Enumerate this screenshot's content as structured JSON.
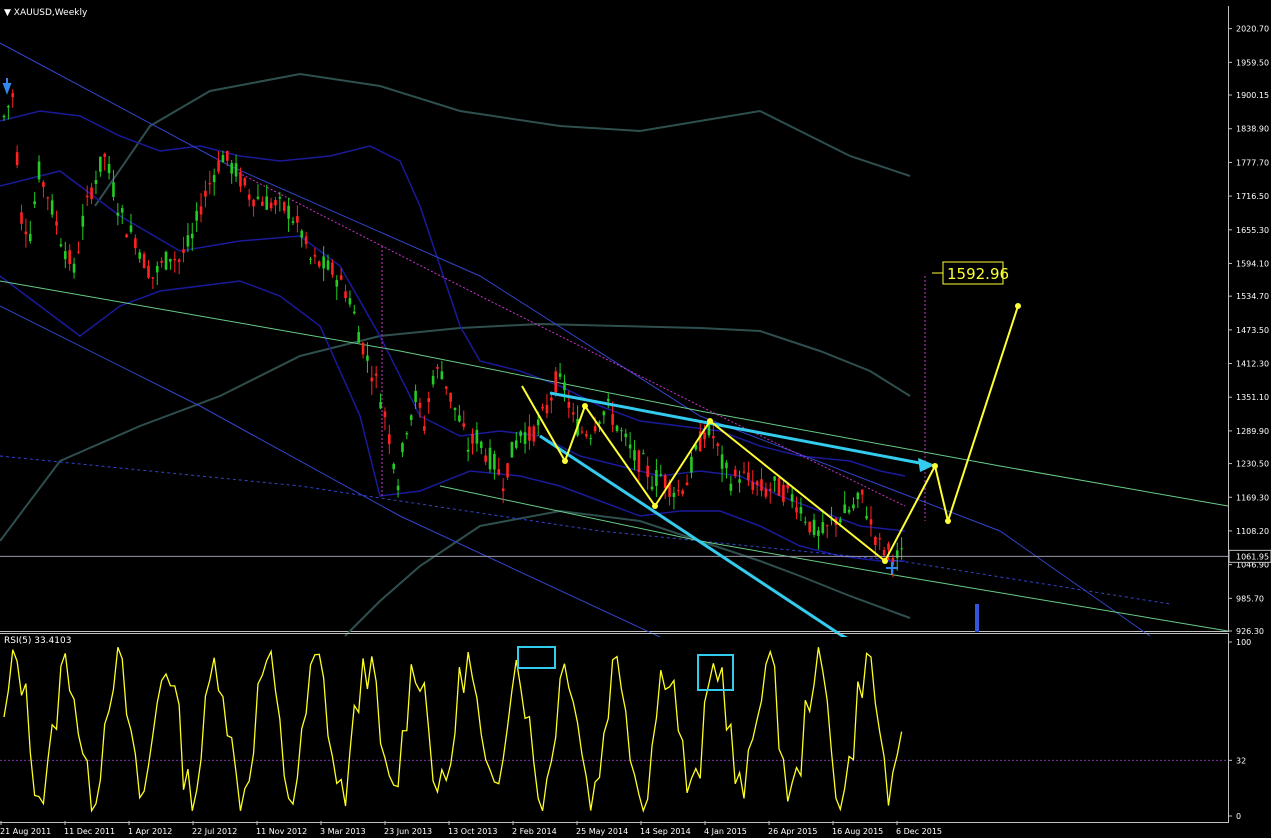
{
  "window": {
    "symbol_title": "XAUUSD,Weekly"
  },
  "rsi_pane": {
    "title": "RSI(5) 33.4103"
  },
  "colors": {
    "background": "#000000",
    "bull_candle": "#22cc22",
    "bear_candle": "#ff2222",
    "bollinger": "#1a1a9a",
    "ma_long": "#2f4f4f",
    "channel_blue": "#3344cc",
    "channel_green": "#66cc88",
    "trend_magenta": "#cc33cc",
    "annotation_yellow": "#ffff33",
    "annotation_cyan": "#33ccee",
    "rsi_line": "#ffff22"
  },
  "chart_data": {
    "type": "candlestick",
    "symbol": "XAUUSD",
    "timeframe": "Weekly",
    "ylim": [
      926.3,
      2051.0
    ],
    "y_ticks": [
      "2020.70",
      "1959.50",
      "1900.15",
      "1838.90",
      "1777.70",
      "1716.50",
      "1655.30",
      "1594.10",
      "1534.70",
      "1473.50",
      "1412.30",
      "1351.10",
      "1289.90",
      "1230.50",
      "1169.30",
      "1108.20",
      "1046.90",
      "985.70",
      "926.30"
    ],
    "x_ticks": [
      "21 Aug 2011",
      "11 Dec 2011",
      "1 Apr 2012",
      "22 Jul 2012",
      "11 Nov 2012",
      "3 Mar 2013",
      "23 Jun 2013",
      "13 Oct 2013",
      "2 Feb 2014",
      "25 May 2014",
      "14 Sep 2014",
      "4 Jan 2015",
      "26 Apr 2015",
      "16 Aug 2015",
      "6 Dec 2015"
    ],
    "current_price": "1061.95",
    "target_label": "1592.96",
    "price_path": [
      [
        0,
        1860
      ],
      [
        2,
        1900
      ],
      [
        4,
        1680
      ],
      [
        6,
        1650
      ],
      [
        8,
        1760
      ],
      [
        10,
        1720
      ],
      [
        13,
        1640
      ],
      [
        16,
        1580
      ],
      [
        18,
        1670
      ],
      [
        20,
        1730
      ],
      [
        23,
        1790
      ],
      [
        24,
        1760
      ],
      [
        26,
        1700
      ],
      [
        28,
        1660
      ],
      [
        30,
        1640
      ],
      [
        32,
        1600
      ],
      [
        34,
        1570
      ],
      [
        36,
        1590
      ],
      [
        38,
        1610
      ],
      [
        40,
        1600
      ],
      [
        43,
        1640
      ],
      [
        45,
        1700
      ],
      [
        48,
        1760
      ],
      [
        50,
        1790
      ],
      [
        53,
        1760
      ],
      [
        56,
        1720
      ],
      [
        59,
        1710
      ],
      [
        62,
        1700
      ],
      [
        65,
        1690
      ],
      [
        68,
        1650
      ],
      [
        70,
        1600
      ],
      [
        73,
        1590
      ],
      [
        75,
        1580
      ],
      [
        77,
        1560
      ],
      [
        79,
        1530
      ],
      [
        81,
        1470
      ],
      [
        83,
        1420
      ],
      [
        85,
        1380
      ],
      [
        87,
        1320
      ],
      [
        89,
        1240
      ],
      [
        90,
        1200
      ],
      [
        92,
        1300
      ],
      [
        94,
        1350
      ],
      [
        96,
        1300
      ],
      [
        98,
        1390
      ],
      [
        100,
        1400
      ],
      [
        102,
        1350
      ],
      [
        104,
        1310
      ],
      [
        106,
        1260
      ],
      [
        108,
        1280
      ],
      [
        110,
        1250
      ],
      [
        112,
        1230
      ],
      [
        114,
        1200
      ],
      [
        116,
        1250
      ],
      [
        118,
        1290
      ],
      [
        120,
        1280
      ],
      [
        122,
        1300
      ],
      [
        124,
        1330
      ],
      [
        126,
        1380
      ],
      [
        128,
        1370
      ],
      [
        130,
        1310
      ],
      [
        132,
        1290
      ],
      [
        134,
        1290
      ],
      [
        136,
        1320
      ],
      [
        138,
        1330
      ],
      [
        140,
        1300
      ],
      [
        142,
        1270
      ],
      [
        144,
        1240
      ],
      [
        146,
        1230
      ],
      [
        148,
        1200
      ],
      [
        150,
        1210
      ],
      [
        152,
        1190
      ],
      [
        154,
        1180
      ],
      [
        156,
        1200
      ],
      [
        158,
        1250
      ],
      [
        160,
        1290
      ],
      [
        162,
        1280
      ],
      [
        164,
        1230
      ],
      [
        166,
        1200
      ],
      [
        168,
        1210
      ],
      [
        170,
        1200
      ],
      [
        172,
        1190
      ],
      [
        174,
        1180
      ],
      [
        176,
        1190
      ],
      [
        178,
        1180
      ],
      [
        180,
        1170
      ],
      [
        182,
        1150
      ],
      [
        184,
        1120
      ],
      [
        186,
        1100
      ],
      [
        188,
        1110
      ],
      [
        190,
        1130
      ],
      [
        192,
        1140
      ],
      [
        194,
        1150
      ],
      [
        196,
        1170
      ],
      [
        198,
        1120
      ],
      [
        200,
        1080
      ],
      [
        202,
        1070
      ],
      [
        204,
        1060
      ],
      [
        206,
        1062
      ]
    ],
    "rsi": {
      "levels": [
        100,
        32,
        0
      ],
      "level_labels": [
        "100",
        "32",
        "0"
      ],
      "current": 33.4103
    }
  }
}
